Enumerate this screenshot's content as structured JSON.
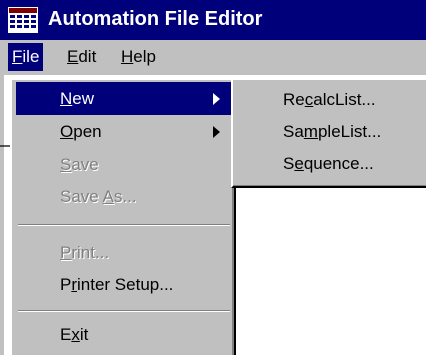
{
  "window": {
    "title": "Automation File Editor",
    "icon": "calculator-grid-icon",
    "colors": {
      "titlebar": "#00007b",
      "menu_bg": "#c0c0c0",
      "highlight": "#00007b",
      "disabled_text": "#808080"
    }
  },
  "menubar": {
    "file": {
      "pre": "",
      "mnemonic": "F",
      "post": "ile"
    },
    "edit": {
      "pre": "",
      "mnemonic": "E",
      "post": "dit"
    },
    "help": {
      "pre": "",
      "mnemonic": "H",
      "post": "elp"
    }
  },
  "file_menu": {
    "new": {
      "pre": "",
      "mnemonic": "N",
      "post": "ew",
      "state": "selected",
      "submenu_icon": "triangle-right-icon"
    },
    "open": {
      "pre": "",
      "mnemonic": "O",
      "post": "pen",
      "state": "enabled",
      "submenu_icon": "triangle-right-icon"
    },
    "save": {
      "pre": "",
      "mnemonic": "S",
      "post": "ave",
      "state": "disabled"
    },
    "save_as": {
      "pre": "Save ",
      "mnemonic": "A",
      "post": "s...",
      "state": "disabled"
    },
    "print": {
      "pre": "",
      "mnemonic": "P",
      "post": "rint...",
      "state": "disabled"
    },
    "printer_setup": {
      "pre": "P",
      "mnemonic": "r",
      "post": "inter Setup...",
      "state": "enabled"
    },
    "exit": {
      "pre": "E",
      "mnemonic": "x",
      "post": "it",
      "state": "enabled"
    }
  },
  "new_submenu": {
    "recalc_list": {
      "pre": "Re",
      "mnemonic": "c",
      "post": "alcList..."
    },
    "sample_list": {
      "pre": "Sa",
      "mnemonic": "m",
      "post": "pleList..."
    },
    "sequence": {
      "pre": "S",
      "mnemonic": "e",
      "post": "quence..."
    }
  }
}
